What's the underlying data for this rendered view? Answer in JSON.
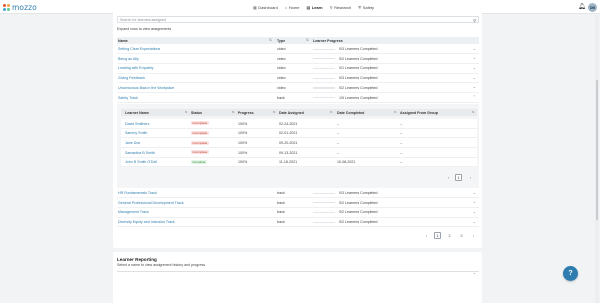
{
  "app": {
    "logo_text": "mozzo",
    "user_initials": "DB",
    "accent": "#2f7dae"
  },
  "nav": [
    {
      "label": "Dashboard",
      "icon": "grid-icon"
    },
    {
      "label": "Home",
      "icon": "home-icon"
    },
    {
      "label": "Learn",
      "icon": "book-icon",
      "active": true
    },
    {
      "label": "Research",
      "icon": "research-icon"
    },
    {
      "label": "Safety",
      "icon": "shield-icon"
    }
  ],
  "search": {
    "placeholder": "Search for learners assigned"
  },
  "hint": "Expand rows to view assignments",
  "columns": {
    "name": "Name",
    "type": "Type",
    "progress": "Learner Progress"
  },
  "assignments": [
    {
      "name": "Setting Clear Expectations",
      "type": "video",
      "progress": "0/3 Learners Completed",
      "fraction": 0
    },
    {
      "name": "Being an Ally",
      "type": "video",
      "progress": "0/2 Learners Completed",
      "fraction": 0
    },
    {
      "name": "Leading with Empathy",
      "type": "video",
      "progress": "0/1 Learners Completed",
      "fraction": 0
    },
    {
      "name": "Giving Feedback",
      "type": "video",
      "progress": "0/3 Learners Completed",
      "fraction": 0
    },
    {
      "name": "Unconscious Bias in the Workplace",
      "type": "video",
      "progress": "0/2 Learners Completed",
      "fraction": 0
    },
    {
      "name": "Safety Track",
      "type": "track",
      "progress": "1/5 Learners Completed",
      "fraction": 0.2
    }
  ],
  "learner_columns": {
    "name": "Learner Name",
    "status": "Status",
    "progress": "Progress",
    "assigned": "Date Assigned",
    "completed": "Date Completed",
    "group": "Assigned From Group"
  },
  "learners": [
    {
      "name": "David Smithers",
      "status": "Incomplete",
      "progress": "100%",
      "assigned": "02-24-2021",
      "completed": "--",
      "group": "--"
    },
    {
      "name": "Sammy Smith",
      "status": "Incomplete",
      "progress": "100%",
      "assigned": "02-01-2021",
      "completed": "--",
      "group": "--"
    },
    {
      "name": "Jane Doe",
      "status": "Incomplete",
      "progress": "100%",
      "assigned": "09-20-2021",
      "completed": "--",
      "group": "--"
    },
    {
      "name": "Samantha B Smith",
      "status": "Incomplete",
      "progress": "100%",
      "assigned": "09-13-2021",
      "completed": "--",
      "group": "--"
    },
    {
      "name": "John B Smith O'Dell",
      "status": "Complete",
      "progress": "100%",
      "assigned": "11-18-2021",
      "completed": "10-08-2021",
      "group": "--"
    }
  ],
  "nested_pagination": {
    "prev": "‹",
    "page": "1",
    "next": "›"
  },
  "assignments_more": [
    {
      "name": "HR Fundamentals Track",
      "type": "track",
      "progress": "0/3 Learners Completed",
      "fraction": 0
    },
    {
      "name": "General Professional Development Track",
      "type": "track",
      "progress": "0/2 Learners Completed",
      "fraction": 0
    },
    {
      "name": "Management Track",
      "type": "track",
      "progress": "0/2 Learners Completed",
      "fraction": 0
    },
    {
      "name": "Diversity Equity and Inclusion Track",
      "type": "track",
      "progress": "0/2 Learners Completed",
      "fraction": 0
    }
  ],
  "pagination": {
    "prev": "‹",
    "pages": [
      "1",
      "2",
      "3"
    ],
    "next": "›"
  },
  "reporting": {
    "title": "Learner Reporting",
    "subtitle": "Select a name to view assignment history and progress"
  },
  "help_label": "?"
}
